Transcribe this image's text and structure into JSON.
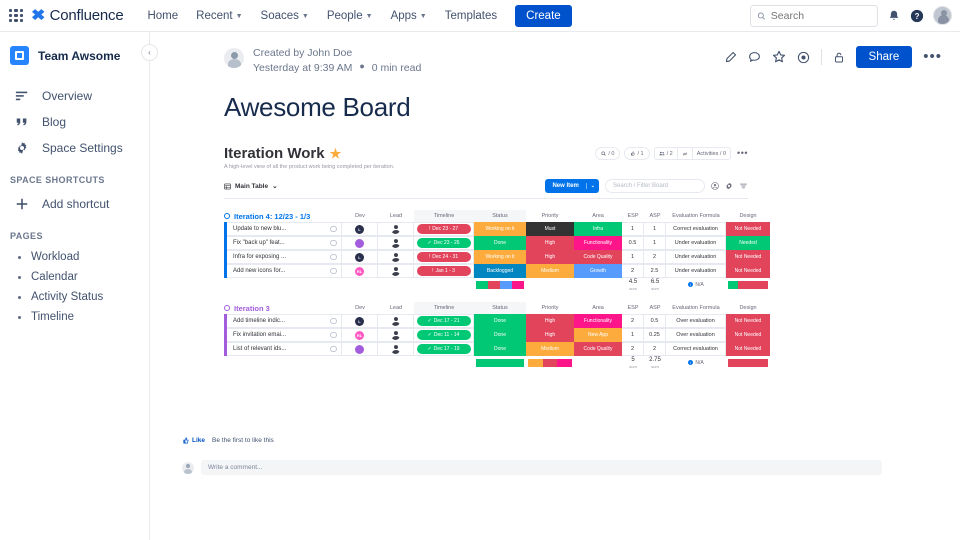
{
  "topnav": {
    "app_grid": "app-switcher",
    "brand": "Confluence",
    "items": [
      {
        "label": "Home",
        "caret": false
      },
      {
        "label": "Recent",
        "caret": true
      },
      {
        "label": "Soaces",
        "caret": true
      },
      {
        "label": "People",
        "caret": true
      },
      {
        "label": "Apps",
        "caret": true
      },
      {
        "label": "Templates",
        "caret": false
      }
    ],
    "create_label": "Create",
    "search_placeholder": "Search",
    "notifications_icon": "bell-icon",
    "help_icon": "help-icon",
    "avatar": "user-avatar"
  },
  "sidebar": {
    "space_name": "Team Awsome",
    "collapse_label": "‹",
    "items": [
      {
        "label": "Overview",
        "icon": "overview-icon"
      },
      {
        "label": "Blog",
        "icon": "quote-icon"
      },
      {
        "label": "Space Settings",
        "icon": "gear-icon"
      }
    ],
    "shortcuts_heading": "SPACE SHORTCUTS",
    "add_shortcut": "Add shortcut",
    "pages_heading": "PAGES",
    "pages": [
      "Workload",
      "Calendar",
      "Activity Status",
      "Timeline"
    ]
  },
  "page": {
    "created_by": "Created by John Doe",
    "meta_time": "Yesterday at 9:39 AM",
    "meta_read": "0 min read",
    "title": "Awesome Board",
    "actions": {
      "edit": "pencil-icon",
      "comment": "comment-icon",
      "star": "star-icon",
      "watch": "eye-icon",
      "restrictions": "lock-icon",
      "share_label": "Share",
      "more": "•••"
    }
  },
  "board": {
    "title": "Iteration Work",
    "star": "★",
    "subtitle": "A high-level view of all the product work being completed per iteration.",
    "stats": [
      {
        "icon": "search-icon",
        "value": "/ 0"
      },
      {
        "icon": "like-icon",
        "value": "/ 1"
      }
    ],
    "members": {
      "icon": "people-icon",
      "value": "/ 2"
    },
    "integrations_icon": "integration-icon",
    "activities_label": "Activities / 0",
    "more": "•••",
    "toolbar": {
      "table_tab": "Main Table",
      "table_caret": "⌄",
      "new_item": "New Item",
      "new_item_caret": "⌄",
      "filter_placeholder": "Search / Filter Board",
      "person_icon": "person-filter-icon",
      "settings_icon": "settings-icon",
      "sort_icon": "sort-icon"
    },
    "columns": [
      "Dev",
      "Lead",
      "Timeline",
      "Status",
      "Priority",
      "Area",
      "ESP",
      "ASP",
      "Evaluation Formula",
      "Design"
    ],
    "groups": [
      {
        "title": "Iteration 4: 12/23 - 1/3",
        "color": "#0073ea",
        "rows": [
          {
            "name": "Update to new blu...",
            "dev": {
              "initials": "L",
              "color": "#292f4c"
            },
            "timeline": {
              "label": "Dec 23 - 27",
              "color": "#e2445c",
              "mark": "!"
            },
            "status": {
              "label": "Working on it",
              "color": "#fdab3d"
            },
            "priority": {
              "label": "Must",
              "color": "#333333"
            },
            "area": {
              "label": "Infra",
              "color": "#00c875"
            },
            "esp": "1",
            "asp": "1",
            "evaluation": "Correct evaluation",
            "design": {
              "label": "Not Needed",
              "color": "#e2445c"
            }
          },
          {
            "name": "Fix \"back up\" feat...",
            "dev": {
              "initials": "",
              "color": "#a25ddc"
            },
            "timeline": {
              "label": "Dec 23 - 26",
              "color": "#00c875",
              "mark": "✓"
            },
            "status": {
              "label": "Done",
              "color": "#00c875"
            },
            "priority": {
              "label": "High",
              "color": "#e2445c"
            },
            "area": {
              "label": "Functionality",
              "color": "#ff158a"
            },
            "esp": "0.5",
            "asp": "1",
            "evaluation": "Under evaluation",
            "design": {
              "label": "Needed",
              "color": "#00c875"
            }
          },
          {
            "name": "Infra for exposing ...",
            "dev": {
              "initials": "L",
              "color": "#292f4c"
            },
            "timeline": {
              "label": "Dec 24 - 31",
              "color": "#e2445c",
              "mark": "!"
            },
            "status": {
              "label": "Working on it",
              "color": "#fdab3d"
            },
            "priority": {
              "label": "High",
              "color": "#e2445c"
            },
            "area": {
              "label": "Code Quality",
              "color": "#e2445c"
            },
            "esp": "1",
            "asp": "2",
            "evaluation": "Under evaluation",
            "design": {
              "label": "Not Needed",
              "color": "#e2445c"
            }
          },
          {
            "name": "Add new icons for...",
            "dev": {
              "initials": "RL",
              "color": "#ff5ac4"
            },
            "timeline": {
              "label": "Jan 1 - 3",
              "color": "#e2445c",
              "mark": "!"
            },
            "status": {
              "label": "Backlogged",
              "color": "#0086c0"
            },
            "priority": {
              "label": "Medium",
              "color": "#fdab3d"
            },
            "area": {
              "label": "Growth",
              "color": "#579bfc"
            },
            "esp": "2",
            "asp": "2.5",
            "evaluation": "Under evaluation",
            "design": {
              "label": "Not Needed",
              "color": "#e2445c"
            }
          }
        ],
        "summary": {
          "status_bars": [
            {
              "color": "#00c875",
              "pct": 25
            },
            {
              "color": "#e2445c",
              "pct": 25
            },
            {
              "color": "#579bfc",
              "pct": 25
            },
            {
              "color": "#ff158a",
              "pct": 25
            }
          ],
          "esp_value": "4.5",
          "esp_label": "sum",
          "asp_value": "6.5",
          "asp_label": "sum",
          "evaluation": "N/A",
          "design_bars": [
            {
              "color": "#00c875",
              "pct": 25
            },
            {
              "color": "#e2445c",
              "pct": 75
            }
          ]
        }
      },
      {
        "title": "Iteration 3",
        "color": "#a25ddc",
        "rows": [
          {
            "name": "Add timeline indic...",
            "dev": {
              "initials": "L",
              "color": "#292f4c"
            },
            "timeline": {
              "label": "Dec 17 - 21",
              "color": "#00c875",
              "mark": "✓"
            },
            "status": {
              "label": "Done",
              "color": "#00c875"
            },
            "priority": {
              "label": "High",
              "color": "#e2445c"
            },
            "area": {
              "label": "Functionality",
              "color": "#ff158a"
            },
            "esp": "2",
            "asp": "0.5",
            "evaluation": "Over evaluation",
            "design": {
              "label": "Not Needed",
              "color": "#e2445c"
            }
          },
          {
            "name": "Fix invitation emai...",
            "dev": {
              "initials": "RL",
              "color": "#ff5ac4"
            },
            "timeline": {
              "label": "Dec 11 - 14",
              "color": "#00c875",
              "mark": "✓"
            },
            "status": {
              "label": "Done",
              "color": "#00c875"
            },
            "priority": {
              "label": "High",
              "color": "#e2445c"
            },
            "area": {
              "label": "New App",
              "color": "#fdab3d"
            },
            "esp": "1",
            "asp": "0.25",
            "evaluation": "Over evaluation",
            "design": {
              "label": "Not Needed",
              "color": "#e2445c"
            }
          },
          {
            "name": "List of relevant ids...",
            "dev": {
              "initials": "",
              "color": "#a25ddc"
            },
            "timeline": {
              "label": "Dec 17 - 19",
              "color": "#00c875",
              "mark": "✓"
            },
            "status": {
              "label": "Done",
              "color": "#00c875"
            },
            "priority": {
              "label": "Medium",
              "color": "#fdab3d"
            },
            "area": {
              "label": "Code Quality",
              "color": "#e2445c"
            },
            "esp": "2",
            "asp": "2",
            "evaluation": "Correct evaluation",
            "design": {
              "label": "Not Needed",
              "color": "#e2445c"
            }
          }
        ],
        "summary": {
          "status_bars": [
            {
              "color": "#00c875",
              "pct": 100
            }
          ],
          "priority_bars": [
            {
              "color": "#fdab3d",
              "pct": 33
            },
            {
              "color": "#e2445c",
              "pct": 34
            },
            {
              "color": "#ff158a",
              "pct": 33
            }
          ],
          "esp_value": "5",
          "esp_label": "sum",
          "asp_value": "2.75",
          "asp_label": "sum",
          "evaluation": "N/A",
          "design_bars": [
            {
              "color": "#e2445c",
              "pct": 100
            }
          ]
        }
      }
    ]
  },
  "footer": {
    "like_label": "Like",
    "like_text": "Be the first to like this",
    "comment_placeholder": "Write a comment..."
  }
}
